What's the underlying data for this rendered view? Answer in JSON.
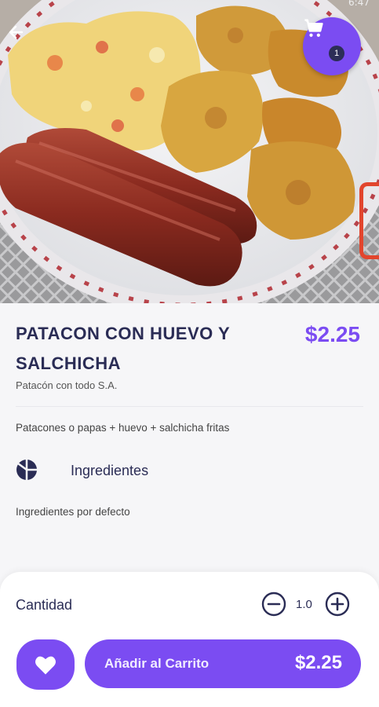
{
  "status_bar": {
    "time": "6:47"
  },
  "cart": {
    "count": "1"
  },
  "product": {
    "name": "PATACON CON HUEVO Y SALCHICHA",
    "price": "$2.25",
    "vendor": "Patacón con todo S.A.",
    "description": "Patacones o papas + huevo + salchicha fritas"
  },
  "ingredients": {
    "label": "Ingredientes",
    "default_text": "Ingredientes por defecto"
  },
  "quantity": {
    "label": "Cantidad",
    "value": "1.0"
  },
  "actions": {
    "add_to_cart_label": "Añadir al Carrito",
    "add_to_cart_price": "$2.25"
  },
  "colors": {
    "accent": "#7b4cf2",
    "title": "#2a2c55",
    "badge": "#2c2e57"
  },
  "icons": [
    "back-arrow-icon",
    "cart-icon",
    "ingredients-icon",
    "minus-circle-icon",
    "plus-circle-icon",
    "heart-icon"
  ]
}
